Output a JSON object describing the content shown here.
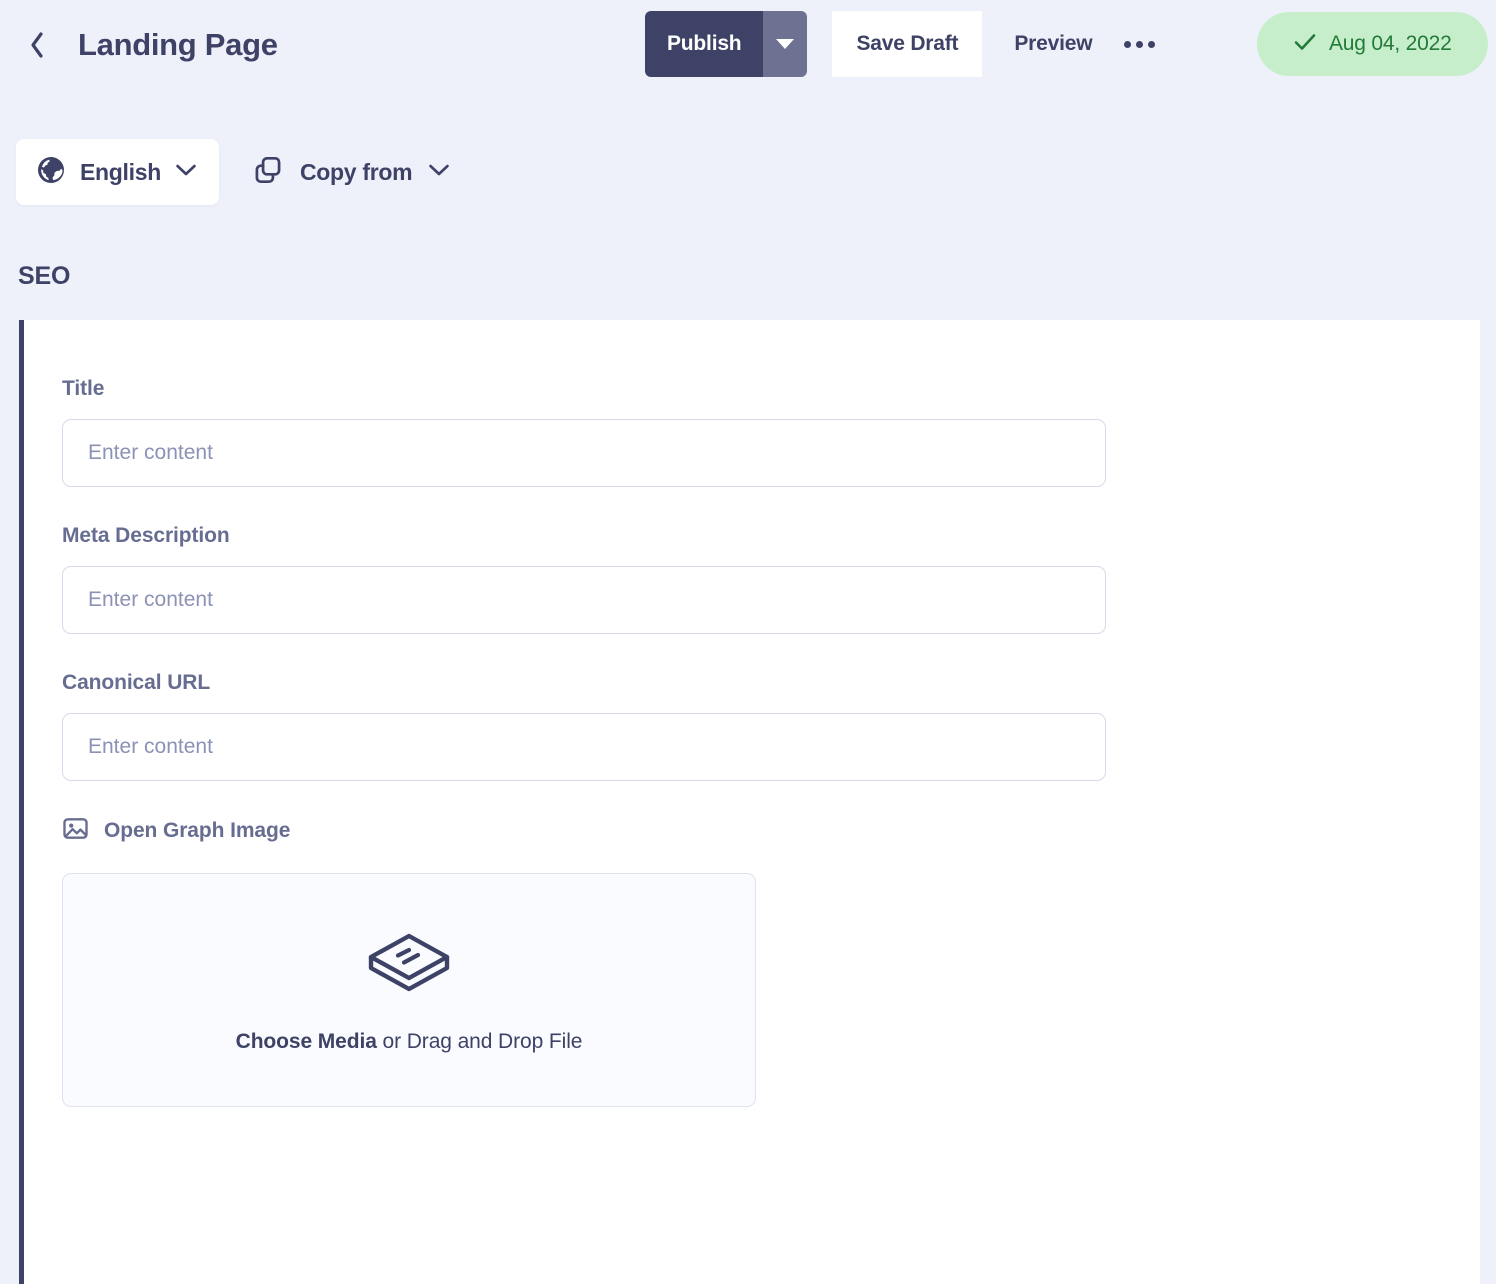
{
  "header": {
    "back_icon": "chevron-left-icon",
    "title": "Landing Page",
    "publish_label": "Publish",
    "publish_caret_icon": "chevron-down-icon",
    "save_draft_label": "Save Draft",
    "preview_label": "Preview",
    "more_icon": "ellipsis-icon",
    "status_badge": {
      "check_icon": "check-icon",
      "date": "Aug 04, 2022",
      "bg_color": "#c7eecb",
      "text_color": "#247a38"
    },
    "publish_bg_color": "#3d4266",
    "publish_caret_bg_color": "#6d7192"
  },
  "toolbar": {
    "language": {
      "icon": "globe-icon",
      "label": "English",
      "caret_icon": "chevron-down-icon"
    },
    "copy_from": {
      "icon": "copy-icon",
      "label": "Copy from",
      "caret_icon": "chevron-down-icon"
    }
  },
  "section": {
    "heading": "SEO",
    "accent_color": "#3d4266",
    "fields": [
      {
        "label": "Title",
        "value": "",
        "placeholder": "Enter content"
      },
      {
        "label": "Meta Description",
        "value": "",
        "placeholder": "Enter content"
      },
      {
        "label": "Canonical URL",
        "value": "",
        "placeholder": "Enter content"
      }
    ],
    "open_graph": {
      "icon": "image-icon",
      "label": "Open Graph Image",
      "dropzone": {
        "icon": "media-box-icon",
        "action_text": "Choose Media",
        "rest_text": " or Drag and Drop File"
      }
    }
  }
}
